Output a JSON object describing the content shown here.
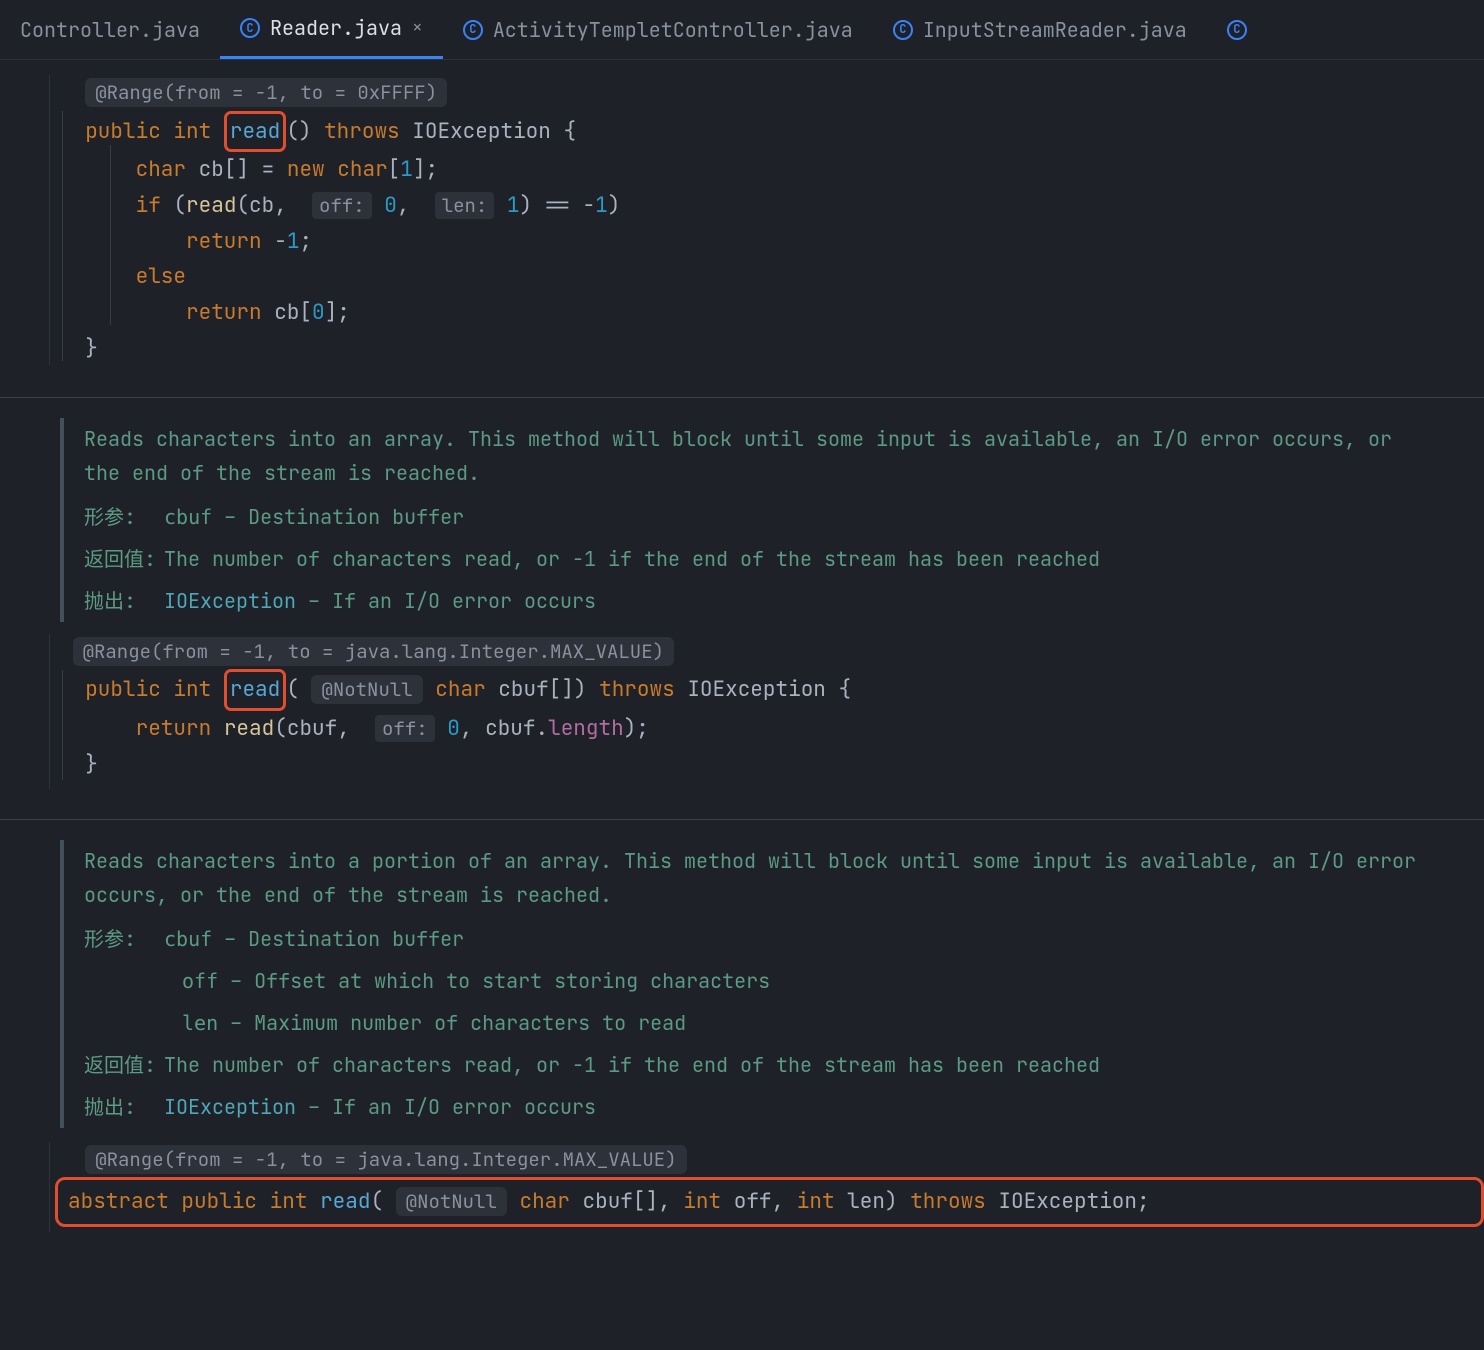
{
  "tabs": [
    {
      "label": "Controller.java"
    },
    {
      "label": "Reader.java",
      "active": true
    },
    {
      "label": "ActivityTempletController.java"
    },
    {
      "label": "InputStreamReader.java"
    }
  ],
  "block1": {
    "annotation": "@Range(from = -1, to = 0xFFFF)",
    "sig": {
      "public": "public",
      "int": "int",
      "read": "read",
      "throws": "throws",
      "ex": "IOException"
    },
    "l1": {
      "char": "char",
      "cb": "cb[] =",
      "new": "new",
      "char2": "char",
      "one": "1"
    },
    "l2": {
      "if": "if",
      "read": "read",
      "cb": "cb,",
      "inlay_off": "off:",
      "zero": "0",
      "comma": ",",
      "inlay_len": "len:",
      "one": "1",
      "eq": ") == -",
      "neg": "1"
    },
    "l3": {
      "return": "return",
      "neg": "-",
      "one": "1"
    },
    "l4": {
      "else": "else"
    },
    "l5": {
      "return": "return",
      "cb": "cb[",
      "zero": "0",
      "end": "];"
    }
  },
  "doc1": {
    "summary": "Reads characters into an array. This method will block until some input is available, an I/O error occurs, or the end of the stream is reached.",
    "param_label": "形参:",
    "param_name": "cbuf",
    "param_desc": " – Destination buffer",
    "return_label": "返回值:",
    "return_desc": "The number of characters read, or -1 if the end of the stream has been reached",
    "throws_label": "抛出:",
    "throws_name": "IOException",
    "throws_desc": " – If an I/O error occurs"
  },
  "block2": {
    "annotation": "@Range(from = -1, to = java.lang.Integer.MAX_VALUE)",
    "sig": {
      "public": "public",
      "int": "int",
      "read": "read",
      "notnull": "@NotNull",
      "char": "char",
      "cbuf": "cbuf[])",
      "throws": "throws",
      "ex": "IOException"
    },
    "l1": {
      "return": "return",
      "read": "read",
      "cbuf": "cbuf,",
      "inlay_off": "off:",
      "zero": "0",
      "comma": ",",
      "cbuf2": "cbuf.",
      "length": "length",
      "end": ");"
    }
  },
  "doc2": {
    "summary": "Reads characters into a portion of an array. This method will block until some input is available, an I/O error occurs, or the end of the stream is reached.",
    "param_label": "形参:",
    "p1n": "cbuf",
    "p1d": " – Destination buffer",
    "p2n": "off",
    "p2d": " – Offset at which to start storing characters",
    "p3n": "len",
    "p3d": " – Maximum number of characters to read",
    "return_label": "返回值:",
    "return_desc": "The number of characters read, or -1 if the end of the stream has been reached",
    "throws_label": "抛出:",
    "throws_name": "IOException",
    "throws_desc": " – If an I/O error occurs"
  },
  "block3": {
    "annotation": "@Range(from = -1, to = java.lang.Integer.MAX_VALUE)",
    "sig": {
      "abstract": "abstract",
      "public": "public",
      "int": "int",
      "read": "read",
      "notnull": "@NotNull",
      "char": "char",
      "cbuf": "cbuf[],",
      "int2": "int",
      "off": "off,",
      "int3": "int",
      "len": "len)",
      "throws": "throws",
      "ex": "IOException;"
    }
  }
}
